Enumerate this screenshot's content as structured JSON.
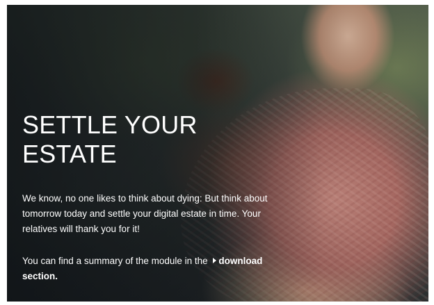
{
  "hero": {
    "title": "SETTLE YOUR ESTATE",
    "paragraph1": "We know, no one likes to think about dying: But think about tomorrow today and settle your digital estate in time. Your relatives will thank you for it!",
    "paragraph2_prefix": "You can find a summary of the module in the ",
    "download_link_label": "download section.",
    "link_icon": "caret-right-icon"
  }
}
